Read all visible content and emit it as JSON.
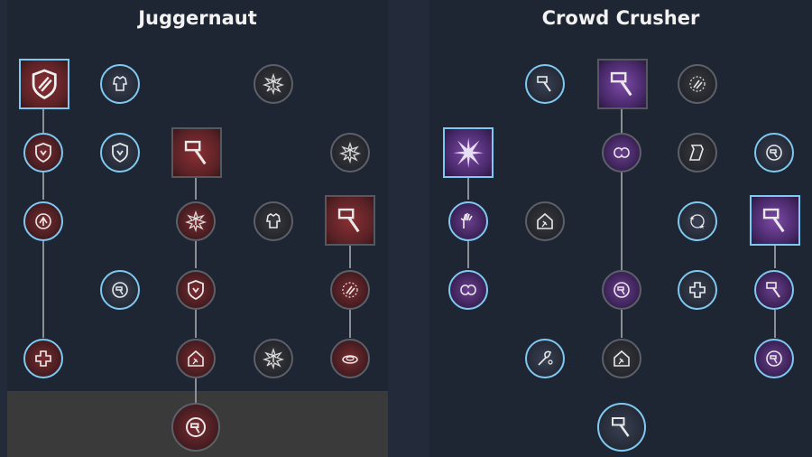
{
  "trees": {
    "left": {
      "title": "Juggernaut"
    },
    "right": {
      "title": "Crowd Crusher"
    }
  },
  "colors": {
    "unlocked_ring": "#7ec9f2",
    "locked_ring": "#5c6068",
    "juggernaut_accent": "#7a2c30",
    "crowd_crusher_accent": "#6a3f8e",
    "background": "#1e2533",
    "title_text": "#f2f2f2"
  },
  "nodes": {
    "j_r1_a": {
      "icon": "shield-slash-icon",
      "state": "selected"
    },
    "j_r1_b": {
      "icon": "armor-icon",
      "state": "available"
    },
    "j_r1_c": {
      "icon": "upgrade-burst-icon",
      "state": "locked"
    },
    "j_r2_a": {
      "icon": "shield-down-icon",
      "state": "selected"
    },
    "j_r2_b": {
      "icon": "shield-down-icon",
      "state": "available"
    },
    "j_r2_c": {
      "icon": "hammer-impact-icon",
      "state": "locked"
    },
    "j_r2_d": {
      "icon": "upgrade-burst-icon",
      "state": "locked"
    },
    "j_r3_a": {
      "icon": "recover-arrow-icon",
      "state": "selected"
    },
    "j_r3_b": {
      "icon": "burst-icon",
      "state": "locked"
    },
    "j_r3_c": {
      "icon": "armor-icon",
      "state": "locked"
    },
    "j_r3_d": {
      "icon": "chain-hammer-icon",
      "state": "locked"
    },
    "j_r4_a": {
      "icon": "hammer-timer-icon",
      "state": "available"
    },
    "j_r4_b": {
      "icon": "shield-down-icon",
      "state": "locked"
    },
    "j_r4_c": {
      "icon": "fist-burst-icon",
      "state": "locked"
    },
    "j_r5_a": {
      "icon": "health-cross-icon",
      "state": "selected"
    },
    "j_r5_b": {
      "icon": "house-hammer-icon",
      "state": "locked"
    },
    "j_r5_c": {
      "icon": "upgrade-burst-icon",
      "state": "locked"
    },
    "j_r5_d": {
      "icon": "shockwave-icon",
      "state": "locked"
    },
    "j_capstone": {
      "icon": "hammer-capstone-icon",
      "state": "locked"
    },
    "c_r1_a": {
      "icon": "hammer-spin-icon",
      "state": "available"
    },
    "c_r1_b": {
      "icon": "slam-hammer-icon",
      "state": "locked"
    },
    "c_r1_c": {
      "icon": "fist-burst-icon",
      "state": "locked"
    },
    "c_r2_a": {
      "icon": "explosion-icon",
      "state": "selected"
    },
    "c_r2_b": {
      "icon": "whirl-icon",
      "state": "locked"
    },
    "c_r2_c": {
      "icon": "scroll-icon",
      "state": "locked"
    },
    "c_r2_d": {
      "icon": "hammer-timer-icon",
      "state": "available"
    },
    "c_r3_a": {
      "icon": "grab-hand-icon",
      "state": "selected"
    },
    "c_r3_b": {
      "icon": "house-hammer-icon",
      "state": "locked"
    },
    "c_r3_c": {
      "icon": "stars-orbit-icon",
      "state": "available"
    },
    "c_r3_d": {
      "icon": "hammer-dash-icon",
      "state": "selected"
    },
    "c_r4_a": {
      "icon": "whirl-icon",
      "state": "selected"
    },
    "c_r4_b": {
      "icon": "hammer-timer-icon",
      "state": "locked"
    },
    "c_r4_c": {
      "icon": "health-cross-icon",
      "state": "available"
    },
    "c_r4_d": {
      "icon": "hammer-smash-icon",
      "state": "selected"
    },
    "c_r5_a": {
      "icon": "axe-freeze-icon",
      "state": "available"
    },
    "c_r5_b": {
      "icon": "house-hammer-icon",
      "state": "locked"
    },
    "c_r5_c": {
      "icon": "hammer-timer-icon",
      "state": "selected"
    },
    "c_capstone": {
      "icon": "hammer-capstone-icon",
      "state": "available"
    }
  }
}
